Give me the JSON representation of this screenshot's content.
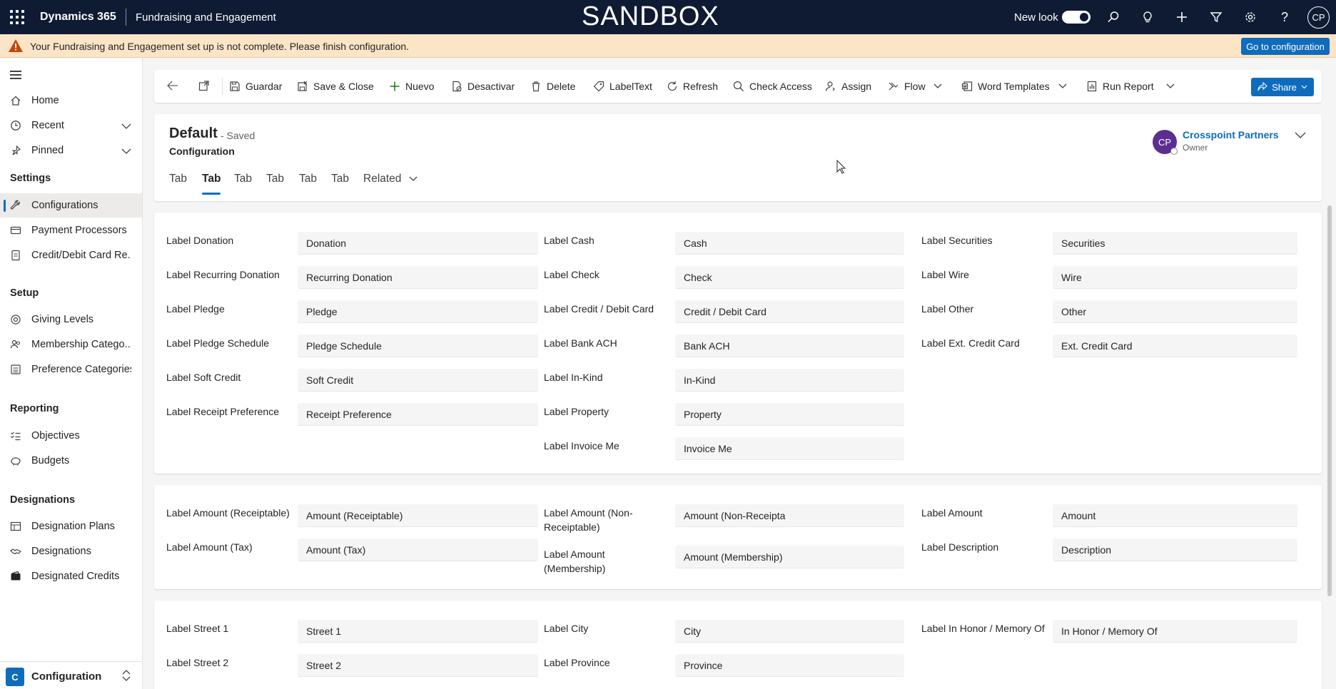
{
  "topbar": {
    "app_name": "Dynamics 365",
    "area_name": "Fundraising and Engagement",
    "environment": "SANDBOX",
    "new_look_label": "New look",
    "new_look_on": true,
    "user_initials": "CP",
    "icons": [
      "search-icon",
      "lightbulb-icon",
      "plus-icon",
      "filter-icon",
      "gear-icon",
      "help-icon"
    ]
  },
  "banner": {
    "message": "Your Fundraising and Engagement set up is not complete. Please finish configuration.",
    "button_label": "Go to configuration",
    "color": "#fce4c7"
  },
  "sidebar": {
    "top_items": [
      {
        "label": "Home",
        "icon": "home-icon"
      },
      {
        "label": "Recent",
        "icon": "clock-icon",
        "expandable": true
      },
      {
        "label": "Pinned",
        "icon": "pin-icon",
        "expandable": true
      }
    ],
    "sections": [
      {
        "title": "Settings",
        "items": [
          {
            "label": "Configurations",
            "icon": "wrench-icon",
            "selected": true
          },
          {
            "label": "Payment Processors",
            "icon": "card-icon"
          },
          {
            "label": "Credit/Debit Card Re...",
            "icon": "document-icon"
          }
        ]
      },
      {
        "title": "Setup",
        "items": [
          {
            "label": "Giving Levels",
            "icon": "target-icon"
          },
          {
            "label": "Membership Catego...",
            "icon": "people-icon"
          },
          {
            "label": "Preference Categories",
            "icon": "list-icon"
          }
        ]
      },
      {
        "title": "Reporting",
        "items": [
          {
            "label": "Objectives",
            "icon": "checklist-icon"
          },
          {
            "label": "Budgets",
            "icon": "piggybank-icon"
          }
        ]
      },
      {
        "title": "Designations",
        "items": [
          {
            "label": "Designation Plans",
            "icon": "table-icon"
          },
          {
            "label": "Designations",
            "icon": "handshake-icon"
          },
          {
            "label": "Designated Credits",
            "icon": "wallet-icon"
          }
        ]
      }
    ],
    "area_switcher": {
      "badge": "C",
      "label": "Configuration"
    }
  },
  "commandbar": {
    "buttons": [
      {
        "label": "Guardar",
        "icon": "save-icon"
      },
      {
        "label": "Save & Close",
        "icon": "save-close-icon"
      },
      {
        "label": "Nuevo",
        "icon": "plus-icon"
      },
      {
        "label": "Desactivar",
        "icon": "deactivate-icon"
      },
      {
        "label": "Delete",
        "icon": "trash-icon"
      },
      {
        "label": "LabelText",
        "icon": "tag-icon"
      },
      {
        "label": "Refresh",
        "icon": "refresh-icon"
      },
      {
        "label": "Check Access",
        "icon": "magnifier-icon"
      },
      {
        "label": "Assign",
        "icon": "person-icon"
      },
      {
        "label": "Flow",
        "icon": "flow-icon",
        "dropdown": true
      },
      {
        "label": "Word Templates",
        "icon": "word-icon",
        "dropdown": true
      },
      {
        "label": "Run Report",
        "icon": "report-icon",
        "dropdown": true
      }
    ],
    "share_label": "Share"
  },
  "record": {
    "title": "Default",
    "status": "- Saved",
    "entity": "Configuration",
    "tabs": [
      "Tab",
      "Tab",
      "Tab",
      "Tab",
      "Tab",
      "Tab",
      "Related"
    ],
    "active_tab_index": 1,
    "owner_initials": "CP",
    "owner_name": "Crosspoint Partners",
    "owner_role": "Owner"
  },
  "sections": [
    {
      "columns": [
        [
          {
            "label": "Label Donation",
            "value": "Donation"
          },
          {
            "label": "Label Recurring Donation",
            "value": "Recurring Donation"
          },
          {
            "label": "Label Pledge",
            "value": "Pledge"
          },
          {
            "label": "Label Pledge Schedule",
            "value": "Pledge Schedule"
          },
          {
            "label": "Label Soft Credit",
            "value": "Soft Credit"
          },
          {
            "label": "Label Receipt Preference",
            "value": "Receipt Preference"
          }
        ],
        [
          {
            "label": "Label Cash",
            "value": "Cash"
          },
          {
            "label": "Label Check",
            "value": "Check"
          },
          {
            "label": "Label Credit / Debit Card",
            "value": "Credit / Debit Card"
          },
          {
            "label": "Label Bank ACH",
            "value": "Bank ACH"
          },
          {
            "label": "Label In-Kind",
            "value": "In-Kind"
          },
          {
            "label": "Label Property",
            "value": "Property"
          },
          {
            "label": "Label Invoice Me",
            "value": "Invoice Me"
          }
        ],
        [
          {
            "label": "Label Securities",
            "value": "Securities"
          },
          {
            "label": "Label Wire",
            "value": "Wire"
          },
          {
            "label": "Label Other",
            "value": "Other"
          },
          {
            "label": "Label Ext. Credit Card",
            "value": "Ext. Credit Card"
          }
        ]
      ]
    },
    {
      "columns": [
        [
          {
            "label": "Label Amount (Receiptable)",
            "value": "Amount (Receiptable)"
          },
          {
            "label": "Label Amount (Tax)",
            "value": "Amount (Tax)"
          }
        ],
        [
          {
            "label": "Label Amount (Non-Receiptable)",
            "value": "Amount (Non-Receipta"
          },
          {
            "label": "Label Amount (Membership)",
            "value": "Amount (Membership)"
          }
        ],
        [
          {
            "label": "Label Amount",
            "value": "Amount"
          },
          {
            "label": "Label Description",
            "value": "Description"
          }
        ]
      ]
    },
    {
      "columns": [
        [
          {
            "label": "Label Street 1",
            "value": "Street 1"
          },
          {
            "label": "Label Street 2",
            "value": "Street 2"
          }
        ],
        [
          {
            "label": "Label City",
            "value": "City"
          },
          {
            "label": "Label Province",
            "value": "Province"
          }
        ],
        [
          {
            "label": "Label In Honor / Memory Of",
            "value": "In Honor / Memory Of"
          }
        ]
      ]
    }
  ],
  "colors": {
    "brand": "#0f6cbd",
    "topbar": "#0f1b33",
    "owner_avatar": "#5c2e91"
  }
}
